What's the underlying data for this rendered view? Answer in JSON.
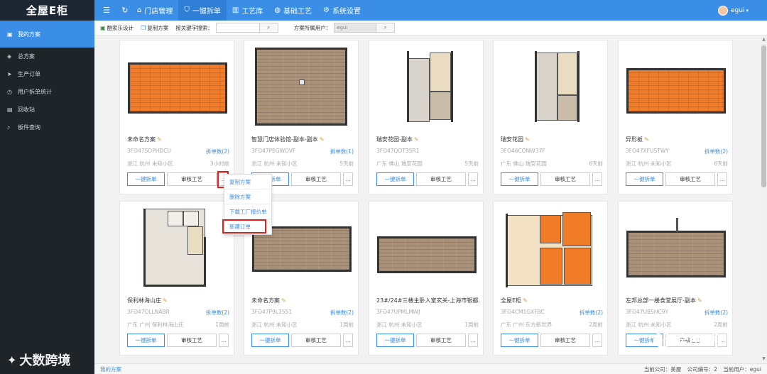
{
  "app": {
    "logo_text": "全屋E柜",
    "user_name": "egui"
  },
  "nav": [
    {
      "label": "门店管理",
      "icon": "home-icon"
    },
    {
      "label": "一键拆单",
      "icon": "shield-icon"
    },
    {
      "label": "工艺库",
      "icon": "library-icon"
    },
    {
      "label": "基础工艺",
      "icon": "palette-icon"
    },
    {
      "label": "系统设置",
      "icon": "gear-icon"
    }
  ],
  "sidebar": [
    {
      "label": "我的方案",
      "icon": "plan-icon"
    },
    {
      "label": "总方案",
      "icon": "diamond-icon"
    },
    {
      "label": "生产订单",
      "icon": "send-icon"
    },
    {
      "label": "用户拆单统计",
      "icon": "clock-icon"
    },
    {
      "label": "回收站",
      "icon": "trash-icon"
    },
    {
      "label": "板件查询",
      "icon": "search-icon"
    }
  ],
  "toolbar": {
    "kujiale_label": "酷家乐设计",
    "copy_label": "复制方案",
    "keyword_label": "按关键字搜索：",
    "keyword_value": "",
    "owner_label": "方案所属用户：",
    "owner_value": "egui"
  },
  "cards": [
    {
      "title": "未命名方案",
      "code": "3FO47SOPHDCU",
      "count": "拆单数(2)",
      "location": "浙江 杭州 未知小区",
      "time": "3小时前"
    },
    {
      "title": "智慧门店体验馆-副本-副本",
      "code": "3FO47PEGWOVF",
      "count": "拆单数(1)",
      "location": "浙江 杭州 未知小区",
      "time": "5天前"
    },
    {
      "title": "瑞安花园-副本",
      "code": "3FO47QOT35R1",
      "count": "",
      "location": "广东 佛山 瑞安花园",
      "time": "5天前"
    },
    {
      "title": "瑞安花园",
      "code": "3FO46CONW37F",
      "count": "",
      "location": "广东 佛山 瑞安花园",
      "time": "6天前"
    },
    {
      "title": "异形板",
      "code": "3FO47XFUSTWY",
      "count": "拆单数(2)",
      "location": "浙江 杭州 未知小区",
      "time": "6天前"
    },
    {
      "title": "保利林海山庄",
      "code": "3FO47OLLNABR",
      "count": "拆单数(2)",
      "location": "广东 广州 保利林海山庄",
      "time": "1周前"
    },
    {
      "title": "未命名方案",
      "code": "3FO47P9L1551",
      "count": "拆单数(2)",
      "location": "浙江 杭州 未知小区",
      "time": "1周前"
    },
    {
      "title": "23#/24#三楼主卧入室玄关-上海市银都...",
      "code": "3FO47UPMLMWJ",
      "count": "",
      "location": "浙江 杭州 未知小区",
      "time": "1周前"
    },
    {
      "title": "全屋E柜",
      "code": "3FO4CM1GXFBC",
      "count": "拆单数(2)",
      "location": "广东 广州 东方新世界",
      "time": "2周前"
    },
    {
      "title": "左邦总部一楼食堂展厅-副本",
      "code": "3FO47UBSHC9Y",
      "count": "拆单数(2)",
      "location": "浙江 杭州 未知小区",
      "time": "2周前"
    }
  ],
  "card_buttons": {
    "primary": "一键拆单",
    "audit": "审核工艺",
    "more": "..."
  },
  "dropdown": [
    "复制方案",
    "删除方案",
    "下载工厂报价单",
    "新建订单"
  ],
  "footer": {
    "breadcrumb": "我的方案",
    "company": "当前公司：美屋",
    "company_no": "公司编号：2",
    "current_user": "当前用户：egui"
  },
  "watermarks": {
    "left": "大数跨境",
    "right": "全屋E柜"
  }
}
